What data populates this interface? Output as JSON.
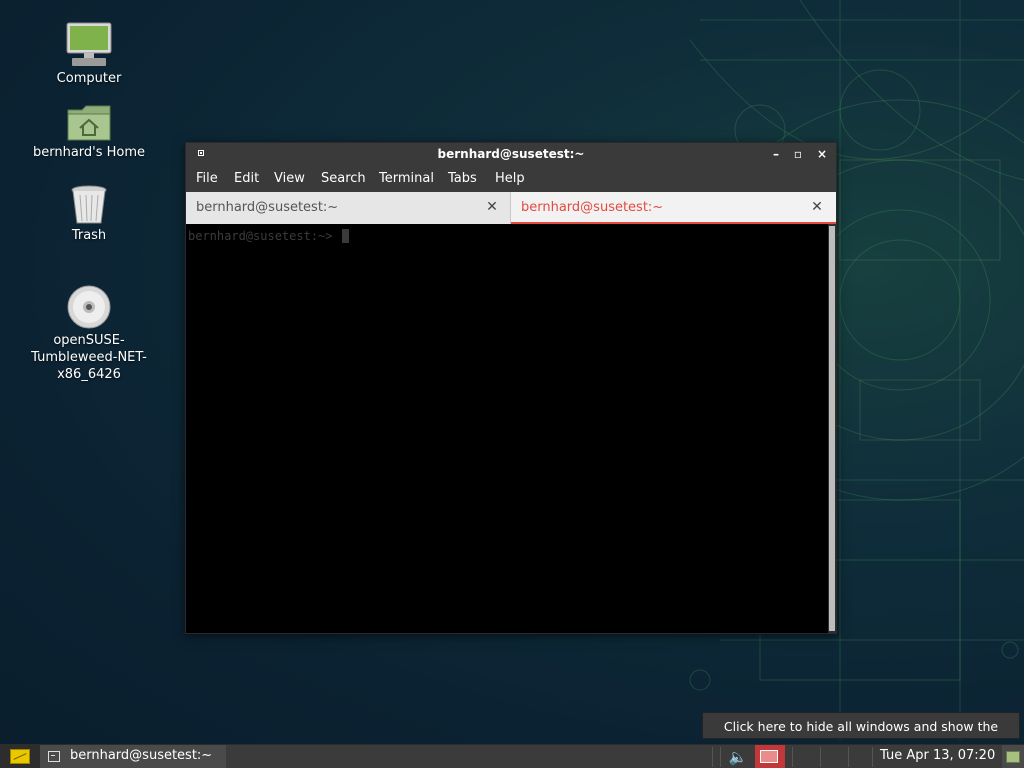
{
  "desktop": {
    "icons": [
      {
        "label": "Computer",
        "icon": "computer-monitor-icon"
      },
      {
        "label": "bernhard's Home",
        "icon": "home-folder-icon"
      },
      {
        "label": "Trash",
        "icon": "trash-bin-icon"
      },
      {
        "label": "openSUSE-\nTumbleweed-NET-\nx86_6426",
        "icon": "optical-disc-icon"
      }
    ]
  },
  "window": {
    "title": "bernhard@susetest:~",
    "controls": {
      "minimize": "–",
      "maximize": "▫",
      "close": "×"
    },
    "menu": [
      "File",
      "Edit",
      "View",
      "Search",
      "Terminal",
      "Tabs",
      "Help"
    ],
    "tabs": [
      {
        "label": "bernhard@susetest:~",
        "active": false
      },
      {
        "label": "bernhard@susetest:~",
        "active": true
      }
    ],
    "tab_close_glyph": "✕",
    "terminal": {
      "prompt": "bernhard@susetest:~> "
    },
    "accent_color": "#e34b40"
  },
  "tooltip": {
    "text": "Click here to hide all windows and show the desktop."
  },
  "taskbar": {
    "task": {
      "label": "bernhard@susetest:~",
      "icon": "terminal-icon"
    },
    "clock": "Tue Apr 13, 07:20",
    "volume_icon": "🔈"
  }
}
